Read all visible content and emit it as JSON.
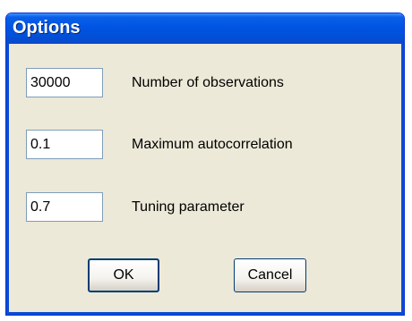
{
  "window": {
    "title": "Options"
  },
  "fields": [
    {
      "value": "30000",
      "label": "Number of observations"
    },
    {
      "value": "0.1",
      "label": "Maximum autocorrelation"
    },
    {
      "value": "0.7",
      "label": "Tuning parameter"
    }
  ],
  "buttons": {
    "ok_label": "OK",
    "cancel_label": "Cancel"
  },
  "colors": {
    "titlebar": "#0054e3",
    "dialog_background": "#ece9d8",
    "input_border": "#7f9db9"
  }
}
